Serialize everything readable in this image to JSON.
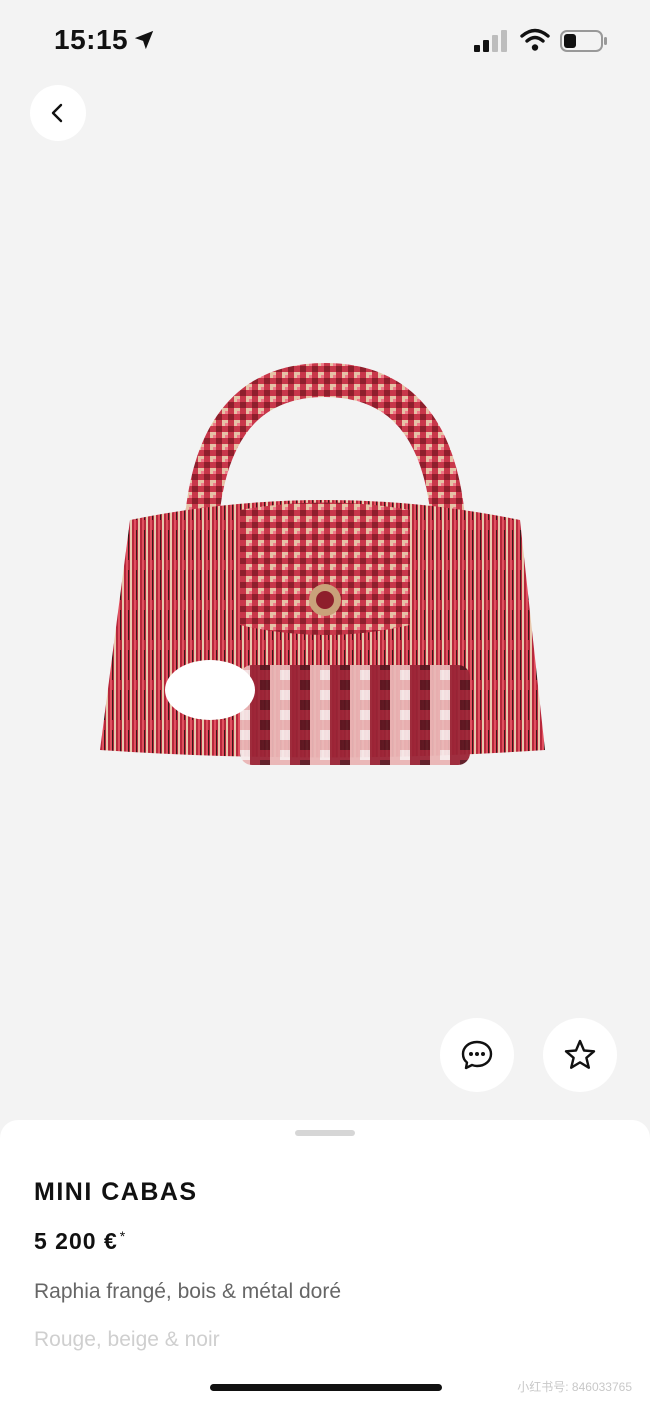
{
  "status_bar": {
    "time": "15:15"
  },
  "icons": {
    "location": "location-arrow-icon",
    "signal": "cellular-signal-icon",
    "wifi": "wifi-icon",
    "battery": "battery-icon",
    "back": "chevron-left-icon",
    "chat": "chat-bubble-icon",
    "favorite": "star-icon"
  },
  "colors": {
    "page_bg": "#f3f3f3",
    "sheet_bg": "#ffffff",
    "product_red": "#c8374a",
    "product_beige": "#e6c2a6"
  },
  "product": {
    "name": "MINI CABAS",
    "price": "5 200 €",
    "price_note": "*",
    "material": "Raphia frangé, bois & métal doré",
    "colors": "Rouge, beige & noir"
  },
  "watermark": "小红书号: 846033765"
}
